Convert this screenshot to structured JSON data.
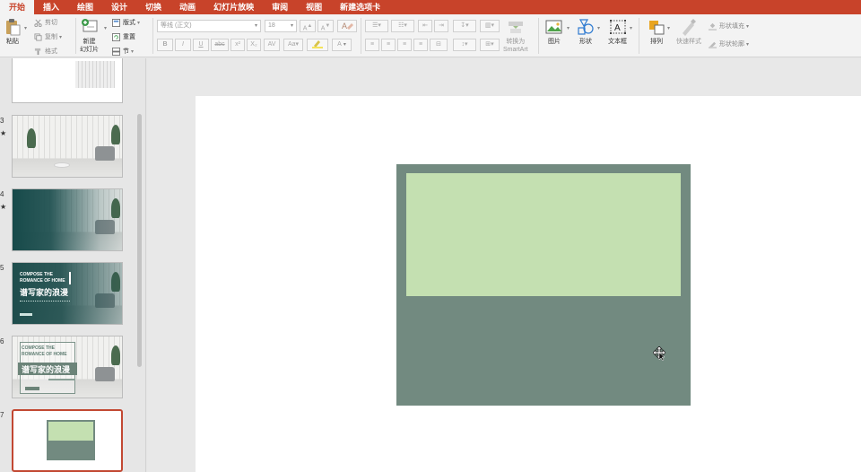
{
  "menu": {
    "tabs": [
      "开始",
      "插入",
      "绘图",
      "设计",
      "切换",
      "动画",
      "幻灯片放映",
      "审阅",
      "视图",
      "新建选项卡"
    ],
    "active": "开始"
  },
  "ribbon": {
    "paste": "粘贴",
    "cut": "剪切",
    "copy": "复制",
    "format_painter": "格式",
    "new_slide_line1": "新建",
    "new_slide_line2": "幻灯片",
    "layout": "版式",
    "reset": "重置",
    "section": "节",
    "font_name": "等线 (正文)",
    "font_size": "18",
    "convert_smartart_line1": "转换为",
    "convert_smartart_line2": "SmartArt",
    "picture": "图片",
    "shape": "形状",
    "textbox": "文本框",
    "arrange": "排列",
    "quick_styles": "快速样式",
    "shape_fill": "形状填充",
    "shape_outline": "形状轮廓",
    "bold": "B",
    "italic": "I",
    "underline": "U",
    "strike": "abc",
    "superscript": "x²",
    "subscript": "X₂",
    "font_color": "A"
  },
  "thumbnails": {
    "items": [
      {
        "number": "3",
        "star": "★"
      },
      {
        "number": "4",
        "star": "★"
      },
      {
        "number": "5",
        "title_line1": "COMPOSE THE",
        "title_line2": "ROMANCE OF HOME",
        "cn": "谱写家的浪漫"
      },
      {
        "number": "6",
        "title_line1": "COMPOSE THE",
        "title_line2": "ROMANCE OF HOME",
        "cn": "谱写家的浪漫"
      },
      {
        "number": "7"
      }
    ]
  },
  "colors": {
    "accent": "#c8432a",
    "outer_rect": "#728a80",
    "inner_rect": "#c4e0b1"
  }
}
